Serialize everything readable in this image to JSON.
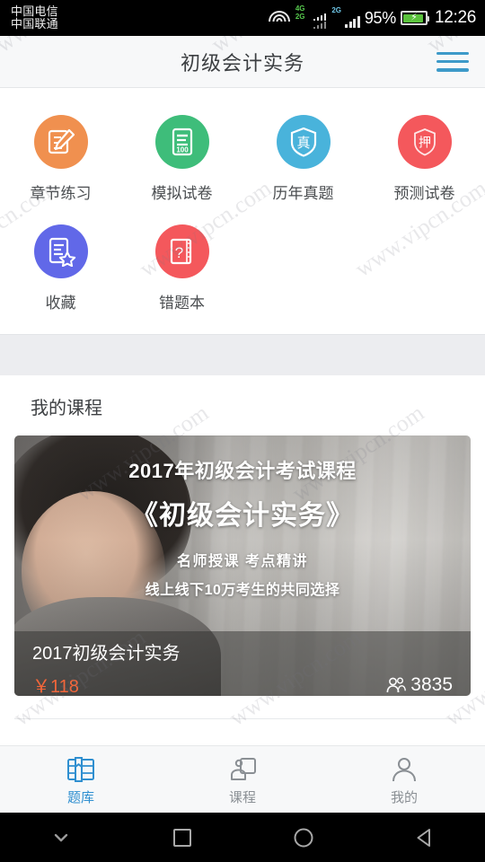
{
  "status_bar": {
    "carrier_1": "中国电信",
    "carrier_2": "中国联通",
    "net_1_top": "4G",
    "net_1_bottom": "2G",
    "net_2": "2G",
    "battery_percent": "95%",
    "clock": "12:26",
    "icons": [
      "wifi-icon",
      "signal-icon",
      "battery-icon"
    ]
  },
  "watermark": {
    "text": "www.vipcn.com"
  },
  "header": {
    "title": "初级会计实务",
    "menu_icon": "hamburger-menu-icon",
    "menu_color": "#3d9ac9"
  },
  "grid": {
    "items": [
      {
        "label": "章节练习",
        "color": "#f0904f",
        "icon": "note-pencil-icon"
      },
      {
        "label": "模拟试卷",
        "color": "#3ebd7a",
        "icon": "document-100-icon"
      },
      {
        "label": "历年真题",
        "color": "#49b3db",
        "icon": "shield-zhen-icon"
      },
      {
        "label": "预测试卷",
        "color": "#f4585c",
        "icon": "shield-ya-icon"
      },
      {
        "label": "收藏",
        "color": "#6168e8",
        "icon": "document-star-icon"
      },
      {
        "label": "错题本",
        "color": "#f4585c",
        "icon": "book-question-icon"
      }
    ],
    "icon_glyphs": {
      "shield_zhen": "真",
      "shield_ya": "押",
      "doc_100": "100",
      "book_question": "?"
    }
  },
  "courses": {
    "section_title": "我的课程",
    "card": {
      "banner_line_1": "2017年初级会计考试课程",
      "banner_line_2": "《初级会计实务》",
      "banner_line_3": "名师授课  考点精讲",
      "banner_line_4": "线上线下10万考生的共同选择",
      "name": "2017初级会计实务",
      "price": "￥118",
      "price_color": "#f4663a",
      "students": "3835",
      "students_icon": "people-icon"
    }
  },
  "bottom_nav": {
    "items": [
      {
        "label": "题库",
        "icon": "question-bank-icon",
        "active": true
      },
      {
        "label": "课程",
        "icon": "course-icon",
        "active": false
      },
      {
        "label": "我的",
        "icon": "user-icon",
        "active": false
      }
    ],
    "active_color": "#2f8fd0",
    "inactive_color": "#8a8f94"
  },
  "android_nav": {
    "buttons": [
      {
        "icon": "chevron-down-icon"
      },
      {
        "icon": "recents-square-icon"
      },
      {
        "icon": "home-circle-icon"
      },
      {
        "icon": "back-triangle-icon"
      }
    ]
  }
}
